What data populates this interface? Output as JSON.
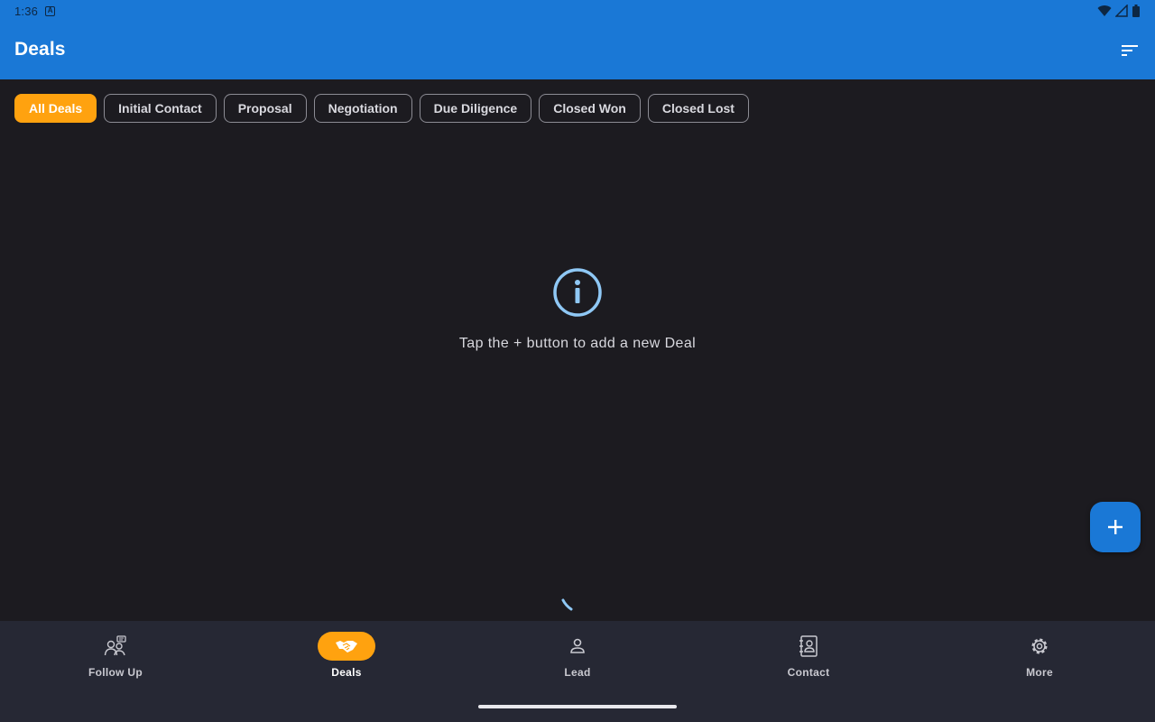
{
  "status_bar": {
    "time": "1:36",
    "notification_icon": "a-icon"
  },
  "app_bar": {
    "title": "Deals",
    "sort_icon": "sort-icon"
  },
  "filters": {
    "chips": [
      "All Deals",
      "Initial Contact",
      "Proposal",
      "Negotiation",
      "Due Diligence",
      "Closed Won",
      "Closed Lost"
    ],
    "selected": "All Deals"
  },
  "empty_state": {
    "icon": "info-icon",
    "message": "Tap the + button to add a new Deal"
  },
  "fab": {
    "icon": "plus-icon"
  },
  "bottom_nav": {
    "items": [
      {
        "label": "Follow Up",
        "icon": "follow-up-icon"
      },
      {
        "label": "Deals",
        "icon": "handshake-icon"
      },
      {
        "label": "Lead",
        "icon": "person-icon"
      },
      {
        "label": "Contact",
        "icon": "contact-book-icon"
      },
      {
        "label": "More",
        "icon": "gear-icon"
      }
    ],
    "active": "Deals"
  },
  "colors": {
    "primary": "#1a78d6",
    "accent": "#ffa20f",
    "background": "#1c1b20",
    "nav_background": "#262834",
    "info_icon": "#8fc8f5"
  }
}
